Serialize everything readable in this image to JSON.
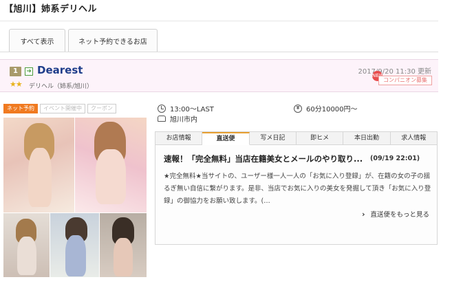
{
  "page": {
    "title": "【旭川】姉系デリヘル"
  },
  "tabs": [
    {
      "label": "すべて表示"
    },
    {
      "label": "ネット予約できるお店"
    }
  ],
  "shop": {
    "rank_icon": "rank-1-icon",
    "rank": "1",
    "name": "Dearest",
    "stars": "★★",
    "category": "デリヘル（姉系/旭川）",
    "updated": "2017/9/20 11:30 更新",
    "new_badge": "NEW",
    "badge": "コンパニオン募集",
    "labels": [
      {
        "label": "ネット予約",
        "active": true
      },
      {
        "label": "イベント開催中",
        "active": false
      },
      {
        "label": "クーポン",
        "active": false
      }
    ],
    "hours": "13:00〜LAST",
    "price": "60分10000円〜",
    "area": "旭川市内"
  },
  "icons": {
    "hours": "clock-icon",
    "price": "yen-icon",
    "area": "car-icon",
    "more": "chevron-right-icon"
  },
  "subtabs": [
    {
      "label": "お店情報",
      "active": false
    },
    {
      "label": "直送便",
      "active": true
    },
    {
      "label": "写メ日記",
      "active": false
    },
    {
      "label": "即ヒメ",
      "active": false
    },
    {
      "label": "本日出勤",
      "active": false
    },
    {
      "label": "求人情報",
      "active": false
    }
  ],
  "post": {
    "title": "速報！「完全無料」当店在籍美女とメールのやり取り...",
    "date": "(09/19 22:01)",
    "body": "★完全無料★当サイトの、ユーザー様一人一人の「お気に入り登録」が、在籍の女の子の揺るぎ無い自信に繋がります。是非、当店でお気に入りの美女を発掘して頂き「お気に入り登録」の御協力をお願い致します。(…",
    "more": "直送便をもっと見る"
  },
  "colors": {
    "accent": "#f07a20",
    "shop_name": "#1e3d8a",
    "band": "#fdf3fa",
    "tab_active": "#e8a030"
  }
}
